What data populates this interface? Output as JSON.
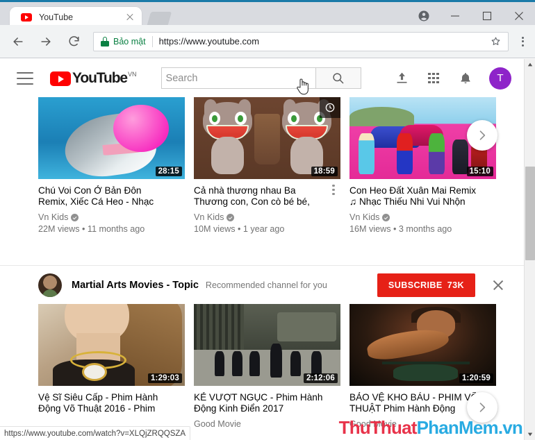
{
  "browser": {
    "tab": {
      "title": "YouTube",
      "favicon": "youtube-icon",
      "close_icon": "close-icon"
    },
    "newtab_label": "",
    "window_controls": {
      "profile": "profile-icon",
      "minimize": "minimize-icon",
      "maximize": "maximize-icon",
      "close": "close-icon"
    },
    "toolbar": {
      "back": "back-arrow-icon",
      "forward": "forward-arrow-icon",
      "reload": "reload-icon",
      "security_label": "Bảo mật",
      "url": "https://www.youtube.com",
      "bookmark": "star-icon",
      "menu": "three-dot-menu-icon"
    },
    "status_url": "https://www.youtube.com/watch?v=XLQjZRQQSZA"
  },
  "youtube": {
    "menu_icon": "hamburger-icon",
    "logo_text": "YouTube",
    "logo_country": "VN",
    "search": {
      "value": "",
      "placeholder": "Search",
      "button_icon": "search-icon"
    },
    "actions": {
      "upload": "upload-icon",
      "apps": "apps-grid-icon",
      "notifications": "bell-icon",
      "avatar_letter": "T"
    }
  },
  "shelves": [
    {
      "id": "shelf-kids",
      "next_arrow": "chevron-right-icon",
      "videos": [
        {
          "art": "a-dolphin",
          "duration": "28:15",
          "title": "Chú Voi Con Ở Bản Đôn Remix, Xiếc Cá Heo - Nhạc",
          "channel": "Vn Kids",
          "verified": true,
          "meta": "22M views • 11 months ago",
          "watch_later": false,
          "kebab": false
        },
        {
          "art": "a-tom",
          "duration": "18:59",
          "title": "Cả nhà thương nhau Ba Thương con, Con cò bé bé,",
          "channel": "Vn Kids",
          "verified": true,
          "meta": "10M views • 1 year ago",
          "watch_later": true,
          "kebab": true
        },
        {
          "art": "a-hero",
          "duration": "15:10",
          "title": "Con Heo Đất Xuân Mai Remix ♫ Nhạc Thiếu Nhi Vui Nhộn",
          "channel": "Vn Kids",
          "verified": true,
          "meta": "16M views • 3 months ago",
          "watch_later": false,
          "kebab": false
        }
      ]
    },
    {
      "id": "shelf-movies",
      "next_arrow": "chevron-right-icon",
      "videos": [
        {
          "art": "a-lady",
          "duration": "1:29:03",
          "title": "Vệ Sĩ Siêu Cấp - Phim Hành Động Võ Thuật 2016 - Phim",
          "channel": "",
          "verified": false,
          "meta": "",
          "watch_later": false,
          "kebab": false
        },
        {
          "art": "a-prison",
          "duration": "2:12:06",
          "title": "KẺ VƯỢT NGỤC - Phim Hành Động Kinh Điển 2017",
          "channel": "Good Movie",
          "verified": false,
          "meta": "",
          "watch_later": false,
          "kebab": false
        },
        {
          "art": "a-rambo",
          "duration": "1:20:59",
          "title": "BẢO VỆ KHO BÁU - PHIM VÕ THUẬT Phim Hành Động",
          "channel": "Good Movie",
          "verified": false,
          "meta": "",
          "watch_later": false,
          "kebab": false
        }
      ]
    }
  ],
  "channel_recommendation": {
    "avatar": "channel-avatar",
    "name": "Martial Arts Movies - Topic",
    "subtitle": "Recommended channel for you",
    "subscribe_label": "SUBSCRIBE",
    "subscriber_count": "73K",
    "dismiss_icon": "close-icon"
  },
  "watermark": {
    "part1": "ThuThuat",
    "part2": "PhanMem.vn"
  },
  "colors": {
    "youtube_red": "#ff0000",
    "subscribe_red": "#e62117",
    "secure_green": "#0b8043",
    "avatar_purple": "#8e24c9",
    "watermark_red": "#e8334a",
    "watermark_blue": "#29abe2"
  }
}
